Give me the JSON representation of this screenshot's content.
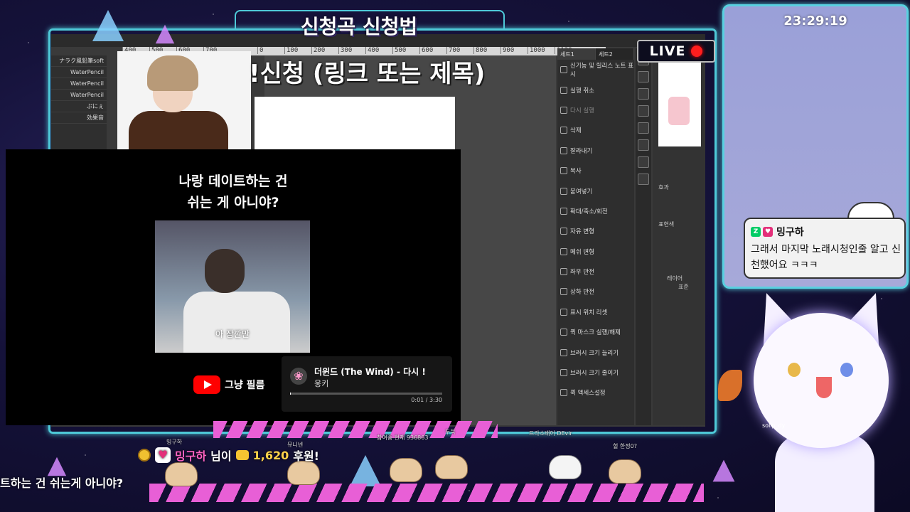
{
  "header": {
    "title": "신청곡 신청법"
  },
  "canvas_overlay": {
    "subtitle": "!신청 (링크 또는 제목)"
  },
  "ruler_ticks": [
    "400",
    "500",
    "600",
    "700",
    "",
    "0",
    "100",
    "200",
    "300",
    "400",
    "500",
    "600",
    "700",
    "800",
    "900",
    "1000",
    "1120"
  ],
  "brushes": [
    "ナラク風鉛筆soft",
    "WaterPencil",
    "WaterPencil",
    "WaterPencil",
    "ぷにぇ",
    "効果音"
  ],
  "menu": {
    "tabs": [
      "세트1",
      "세트2"
    ],
    "items": [
      {
        "label": "신기능 및 릴리스 노트 표시",
        "dim": false
      },
      {
        "label": "실행 취소",
        "dim": false
      },
      {
        "label": "다시 실행",
        "dim": true
      },
      {
        "label": "삭제",
        "dim": false
      },
      {
        "label": "잘라내기",
        "dim": false
      },
      {
        "label": "복사",
        "dim": false
      },
      {
        "label": "붙여넣기",
        "dim": false
      },
      {
        "label": "확대/축소/회전",
        "dim": false
      },
      {
        "label": "자유 변형",
        "dim": false
      },
      {
        "label": "메쉬 변형",
        "dim": false
      },
      {
        "label": "좌우 반전",
        "dim": false
      },
      {
        "label": "상하 반전",
        "dim": false
      },
      {
        "label": "표시 위치 리셋",
        "dim": false
      },
      {
        "label": "퀵 마스크 실행/해제",
        "dim": false
      },
      {
        "label": "브러시 크기 늘리기",
        "dim": false
      },
      {
        "label": "브러시 크기 줄이기",
        "dim": false
      },
      {
        "label": "퀵 액세스설정",
        "dim": false
      }
    ]
  },
  "layers_panel": {
    "effect_label": "효과",
    "color_label": "표현색",
    "layer_label": "레이어",
    "blend_label": "표준"
  },
  "video": {
    "caption_line1": "나랑 데이트하는 건",
    "caption_line2": "쉬는 게 아니야?",
    "in_video_subtitle": "아 잠깐만",
    "channel_name": "그냥 필름"
  },
  "player": {
    "title": "더윈드 (The Wind) - 다시 !",
    "artist": "웅키",
    "progress": 0.005,
    "time": "0:01 / 3:30"
  },
  "live": {
    "label": "LIVE"
  },
  "side": {
    "clock": "23:29:19"
  },
  "chat": {
    "badge": "Z",
    "user": "밍구하",
    "message": "그래서 마지막 노래시청인줄 알고 신천했어요 ㅋㅋㅋ"
  },
  "mascot": {
    "tag": "solip_dy"
  },
  "donation": {
    "user": "밍구하",
    "suffix": "님이",
    "amount": "1,620",
    "unit": "후원!"
  },
  "ticker": {
    "text": "트하는 건 쉬는게 아니야?"
  },
  "mini_labels": {
    "a": "밍구하",
    "b": "뮤니넨",
    "c": "참여중 현재 936863",
    "d": "두둑",
    "e": "트라소배어 DEvir",
    "f": "헐 한정0?"
  },
  "colors": {
    "neon": "#4ec9d8",
    "pink": "#e85fd6",
    "live_red": "#ff1e1e",
    "donor": "#ff63c3"
  }
}
